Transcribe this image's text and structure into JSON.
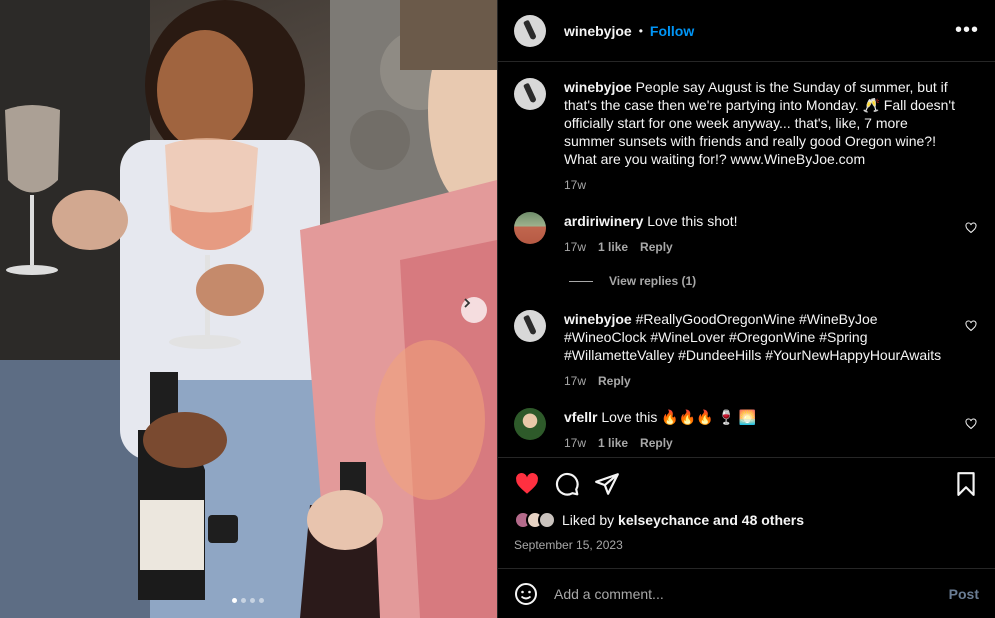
{
  "post": {
    "username": "winebyjoe",
    "follow_label": "Follow",
    "separator": "•",
    "more_label": "•••",
    "caption": {
      "username": "winebyjoe",
      "text": "People say August is the Sunday of summer, but if that's the case then we're partying into Monday. 🥂 Fall doesn't officially start for one week anyway... that's, like, 7 more summer sunsets with friends and really good Oregon wine?! What are you waiting for!? www.WineByJoe.com",
      "age": "17w"
    },
    "comments": [
      {
        "username": "ardiriwinery",
        "text": "Love this shot!",
        "age": "17w",
        "likes": "1 like",
        "reply": "Reply",
        "view_replies": "View replies (1)"
      },
      {
        "username": "winebyjoe",
        "text": "#ReallyGoodOregonWine #WineByJoe #WineoClock #WineLover #OregonWine #Spring #WillametteValley #DundeeHills #YourNewHappyHourAwaits",
        "age": "17w",
        "reply": "Reply"
      },
      {
        "username": "vfellr",
        "text": "Love this 🔥🔥🔥 🍷 🌅",
        "age": "17w",
        "likes": "1 like",
        "reply": "Reply"
      }
    ],
    "likes": {
      "prefix": "Liked by",
      "user": "kelseychance",
      "and": "and",
      "others": "48 others"
    },
    "date": "September 15, 2023",
    "add_comment": {
      "placeholder": "Add a comment...",
      "post_label": "Post"
    },
    "carousel": {
      "total": 4,
      "active_index": 0
    },
    "colors": {
      "accent": "#0095f6",
      "like_red": "#ff3040",
      "muted": "#a8a8a8",
      "background": "#000000"
    },
    "icons": [
      "more-icon",
      "heart-icon",
      "comment-icon",
      "share-icon",
      "bookmark-icon",
      "emoji-icon",
      "chevron-right-icon"
    ]
  }
}
